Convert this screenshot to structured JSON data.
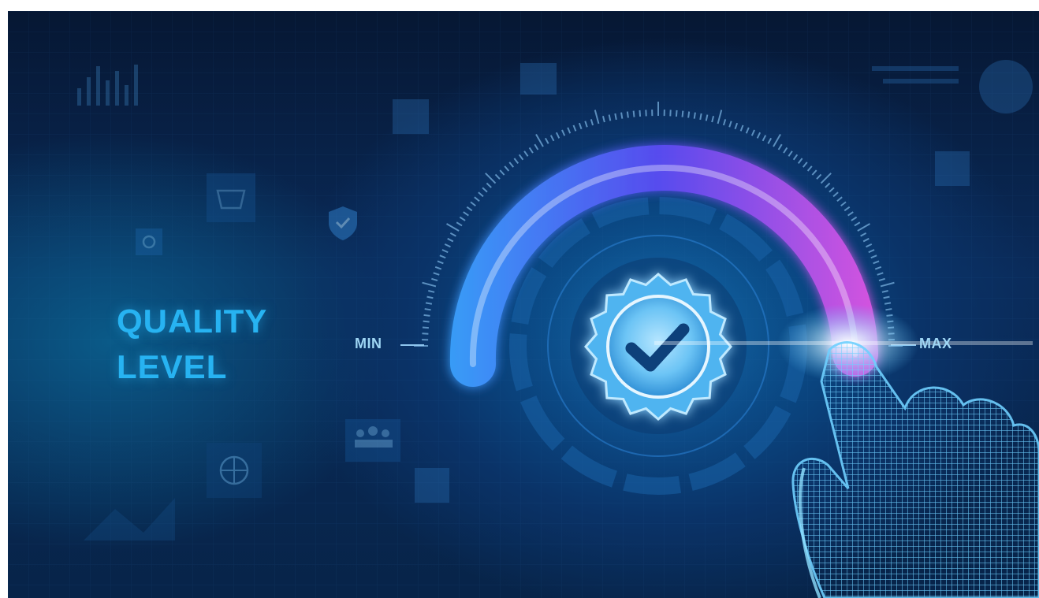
{
  "heading": {
    "line1": "QUALITY",
    "line2": "LEVEL"
  },
  "gauge": {
    "min_label": "MIN",
    "max_label": "MAX",
    "level_percent": 97
  },
  "colors": {
    "background_dark": "#061733",
    "background_mid": "#0a4a86",
    "title_blue": "#27b3f2",
    "arc_start": "#38a8ff",
    "arc_mid": "#5b4df5",
    "arc_end": "#e455e4",
    "badge_fill": "#6cc4f5",
    "hand_wireframe": "#4fc3ff"
  },
  "icons": [
    "bar-chart-icon",
    "basket-icon",
    "shield-check-icon",
    "people-icon",
    "globe-icon",
    "settings-icon",
    "check-badge-icon",
    "wireframe-hand-icon"
  ]
}
